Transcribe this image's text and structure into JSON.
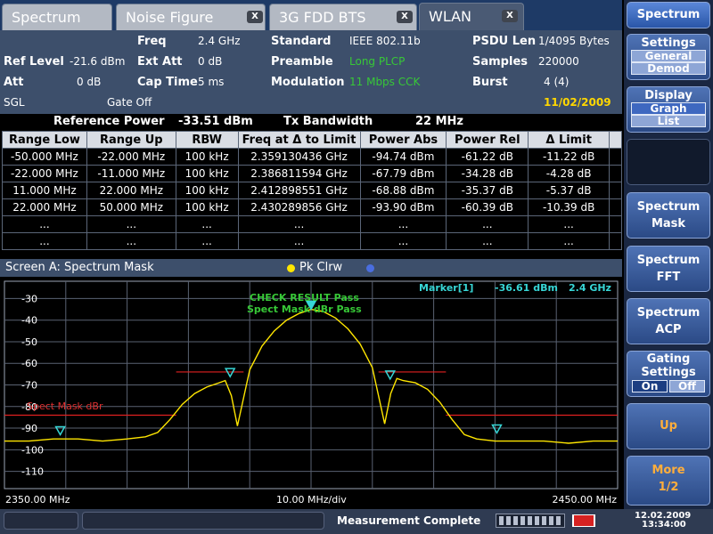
{
  "tabs": [
    {
      "label": "Spectrum",
      "active": false,
      "closable": false
    },
    {
      "label": "Noise Figure",
      "active": false,
      "closable": true
    },
    {
      "label": "3G FDD BTS",
      "active": false,
      "closable": true
    },
    {
      "label": "WLAN",
      "active": true,
      "closable": true
    }
  ],
  "tab_close_glyph": "X",
  "info": {
    "freq_label": "Freq",
    "freq_value": "2.4 GHz",
    "ref_level_label": "Ref Level",
    "ref_level_value": "-21.6 dBm",
    "ext_att_label": "Ext Att",
    "ext_att_value": "0 dB",
    "att_label": "Att",
    "att_value": "0 dB",
    "cap_time_label": "Cap Time",
    "cap_time_value": "5 ms",
    "sgl": "SGL",
    "gate": "Gate Off",
    "standard_label": "Standard",
    "standard_value": "IEEE 802.11b",
    "preamble_label": "Preamble",
    "preamble_value": "Long PLCP",
    "modulation_label": "Modulation",
    "modulation_value": "11 Mbps CCK",
    "psdu_label": "PSDU Len",
    "psdu_value": "1/4095 Bytes",
    "samples_label": "Samples",
    "samples_value": "220000",
    "burst_label": "Burst",
    "burst_value": "4 (4)",
    "date": "11/02/2009"
  },
  "ref_bar": {
    "ref_power_label": "Reference Power",
    "ref_power_value": "-33.51 dBm",
    "tx_bw_label": "Tx Bandwidth",
    "tx_bw_value": "22 MHz"
  },
  "table": {
    "headers": [
      "Range Low",
      "Range Up",
      "RBW",
      "Freq at Δ to Limit",
      "Power Abs",
      "Power Rel",
      "Δ Limit"
    ],
    "rows": [
      [
        "-50.000 MHz",
        "-22.000 MHz",
        "100 kHz",
        "2.359130436 GHz",
        "-94.74 dBm",
        "-61.22 dB",
        "-11.22 dB"
      ],
      [
        "-22.000 MHz",
        "-11.000 MHz",
        "100 kHz",
        "2.386811594 GHz",
        "-67.79 dBm",
        "-34.28 dB",
        "-4.28 dB"
      ],
      [
        "11.000 MHz",
        "22.000 MHz",
        "100 kHz",
        "2.412898551 GHz",
        "-68.88 dBm",
        "-35.37 dB",
        "-5.37 dB"
      ],
      [
        "22.000 MHz",
        "50.000 MHz",
        "100 kHz",
        "2.430289856 GHz",
        "-93.90 dBm",
        "-60.39 dB",
        "-10.39 dB"
      ],
      [
        "...",
        "...",
        "...",
        "...",
        "...",
        "...",
        "..."
      ],
      [
        "...",
        "...",
        "...",
        "...",
        "...",
        "...",
        "..."
      ]
    ]
  },
  "graph": {
    "title": "Screen A: Spectrum Mask",
    "trace_label": "Pk Clrw",
    "trace1_color": "#ffe600",
    "trace2_color": "#4a6ee0",
    "marker_label": "Marker[1]",
    "marker_level": "-36.61 dBm",
    "marker_freq": "2.4 GHz",
    "check_result": "CHECK RESULT  Pass",
    "spect_mask_result": "Spect Mask dBr  Pass",
    "limit_line_label": "Spect Mask dBr",
    "x_start": "2350.00 MHz",
    "x_div": "10.00 MHz/div",
    "x_stop": "2450.00 MHz"
  },
  "chart_data": {
    "type": "line",
    "title": "Screen A: Spectrum Mask",
    "xlabel": "10.00 MHz/div",
    "ylabel": "",
    "xlim": [
      2350,
      2450
    ],
    "ylim": [
      -118,
      -22
    ],
    "y_ticks": [
      -30,
      -40,
      -50,
      -60,
      -70,
      -80,
      -90,
      -100,
      -110
    ],
    "grid": true,
    "series": [
      {
        "name": "Pk Clrw",
        "x": [
          2350,
          2354,
          2358,
          2362,
          2366,
          2370,
          2373,
          2375,
          2377,
          2379,
          2381,
          2383,
          2385,
          2386,
          2387,
          2388,
          2389,
          2390,
          2392,
          2394,
          2396,
          2398,
          2400,
          2402,
          2404,
          2406,
          2408,
          2410,
          2411,
          2412,
          2413,
          2414,
          2415,
          2417,
          2419,
          2421,
          2423,
          2425,
          2427,
          2430,
          2434,
          2438,
          2442,
          2446,
          2450
        ],
        "y": [
          -96,
          -96,
          -95,
          -95,
          -96,
          -95,
          -94,
          -92,
          -86,
          -79,
          -74,
          -71,
          -69,
          -68,
          -75,
          -89,
          -76,
          -63,
          -52,
          -45,
          -40,
          -37,
          -35,
          -36,
          -39,
          -44,
          -51,
          -62,
          -75,
          -88,
          -74,
          -67,
          -68,
          -69,
          -72,
          -78,
          -86,
          -93,
          -95,
          -96,
          -96,
          -96,
          -97,
          -96,
          -96
        ]
      }
    ],
    "limit_lines": [
      {
        "x": [
          2350,
          2378
        ],
        "y": [
          -84,
          -84
        ]
      },
      {
        "x": [
          2378,
          2389
        ],
        "y": [
          -64,
          -64
        ]
      },
      {
        "x": [
          2411,
          2422
        ],
        "y": [
          -64,
          -64
        ]
      },
      {
        "x": [
          2422,
          2450
        ],
        "y": [
          -84,
          -84
        ]
      }
    ],
    "markers": [
      {
        "x": 2359.1,
        "y": -94.7
      },
      {
        "x": 2386.8,
        "y": -67.8
      },
      {
        "x": 2400,
        "y": -36.6
      },
      {
        "x": 2412.9,
        "y": -68.9
      },
      {
        "x": 2430.3,
        "y": -93.9
      }
    ]
  },
  "status": {
    "message": "Measurement Complete",
    "date": "12.02.2009",
    "time": "13:34:00"
  },
  "side": {
    "header": "Spectrum",
    "settings_label": "Settings",
    "general_label": "General",
    "demod_label": "Demod",
    "display_label": "Display",
    "graph_label": "Graph",
    "list_label": "List",
    "spectrum_mask": [
      "Spectrum",
      "Mask"
    ],
    "spectrum_fft": [
      "Spectrum",
      "FFT"
    ],
    "spectrum_acp": [
      "Spectrum",
      "ACP"
    ],
    "gating_label": "Gating",
    "gating_settings_label": "Settings",
    "on_label": "On",
    "off_label": "Off",
    "up_label": "Up",
    "more_label": "More",
    "more_page": "1/2"
  }
}
